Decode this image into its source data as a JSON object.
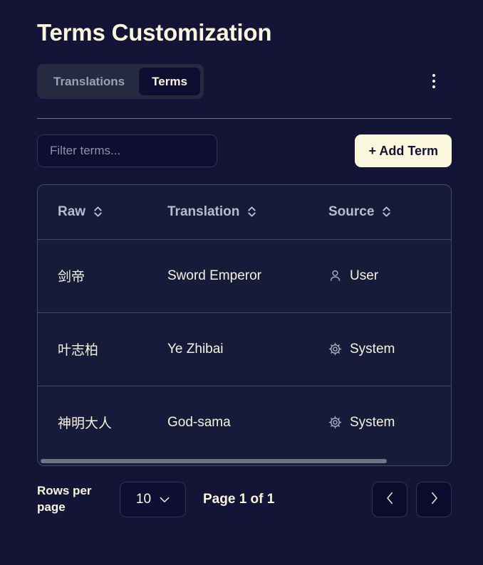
{
  "header": {
    "title": "Terms Customization",
    "menu_icon": "kebab-menu-icon"
  },
  "tabs": [
    {
      "label": "Translations",
      "active": false
    },
    {
      "label": "Terms",
      "active": true
    }
  ],
  "toolbar": {
    "filter_placeholder": "Filter terms...",
    "filter_value": "",
    "add_label": "+ Add Term"
  },
  "table": {
    "columns": [
      {
        "label": "Raw",
        "sortable": true
      },
      {
        "label": "Translation",
        "sortable": true
      },
      {
        "label": "Source",
        "sortable": true
      }
    ],
    "rows": [
      {
        "raw": "剑帝",
        "translation": "Sword Emperor",
        "source": "User",
        "source_icon": "user-icon"
      },
      {
        "raw": "叶志柏",
        "translation": "Ye Zhibai",
        "source": "System",
        "source_icon": "gear-icon"
      },
      {
        "raw": "神明大人",
        "translation": "God-sama",
        "source": "System",
        "source_icon": "gear-icon"
      }
    ]
  },
  "pagination": {
    "rows_per_page_label": "Rows per page",
    "rows_per_page_value": "10",
    "page_status": "Page 1 of 1",
    "prev_icon": "chevron-left-icon",
    "next_icon": "chevron-right-icon"
  },
  "colors": {
    "background": "#141436",
    "accent_cream": "#FAF6DC",
    "panel": "#161B39",
    "border": "#434865",
    "muted_text": "#9BA2B5"
  }
}
